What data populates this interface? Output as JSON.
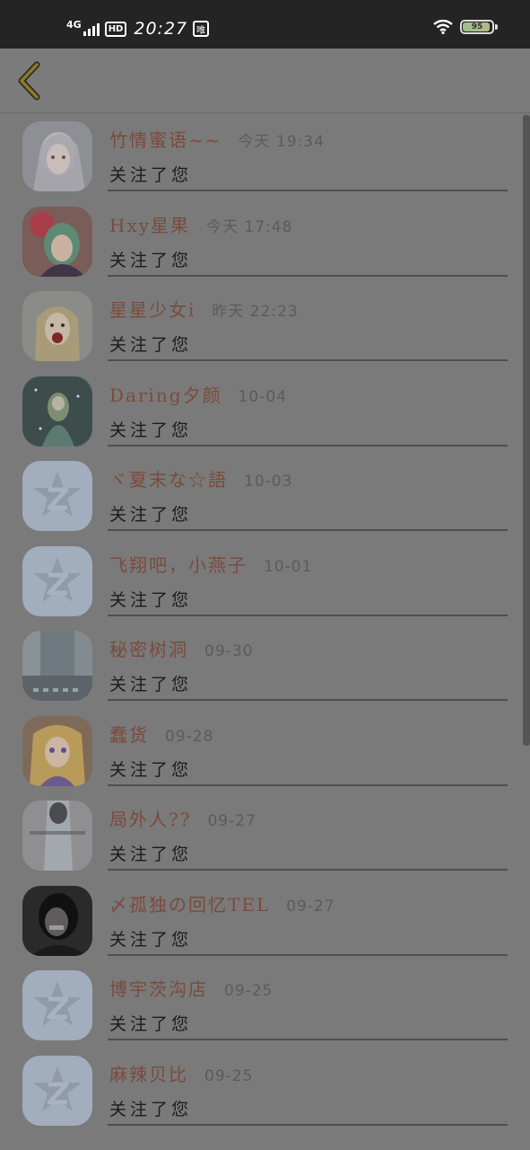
{
  "status_bar": {
    "network": "4G",
    "hd": "HD",
    "time": "20:27",
    "app_badge": "唯",
    "battery": "95",
    "battery_level": 0.95
  },
  "header": {
    "back_icon": "chevron-left-icon"
  },
  "rows": [
    {
      "name": "竹情蜜语~~",
      "time": "今天 19:34",
      "message": "关注了您"
    },
    {
      "name": "Hxy星果",
      "time": "今天 17:48",
      "message": "关注了您"
    },
    {
      "name": "星星少女i",
      "time": "昨天 22:23",
      "message": "关注了您"
    },
    {
      "name": "Daring夕颜",
      "time": "10-04",
      "message": "关注了您"
    },
    {
      "name": "ヾ夏末な☆語",
      "time": "10-03",
      "message": "关注了您"
    },
    {
      "name": "飞翔吧，小燕子",
      "time": "10-01",
      "message": "关注了您"
    },
    {
      "name": "秘密树洞",
      "time": "09-30",
      "message": "关注了您"
    },
    {
      "name": "蠢货",
      "time": "09-28",
      "message": "关注了您"
    },
    {
      "name": "局外人??",
      "time": "09-27",
      "message": "关注了您"
    },
    {
      "name": "〆孤独の回忆TEL",
      "time": "09-27",
      "message": "关注了您"
    },
    {
      "name": "博宇茨沟店",
      "time": "09-25",
      "message": "关注了您"
    },
    {
      "name": "麻辣贝比",
      "time": "09-25",
      "message": "关注了您"
    }
  ],
  "colors": {
    "name": "#7b4a3c",
    "placeholder_avatar": "#a2adbd"
  }
}
